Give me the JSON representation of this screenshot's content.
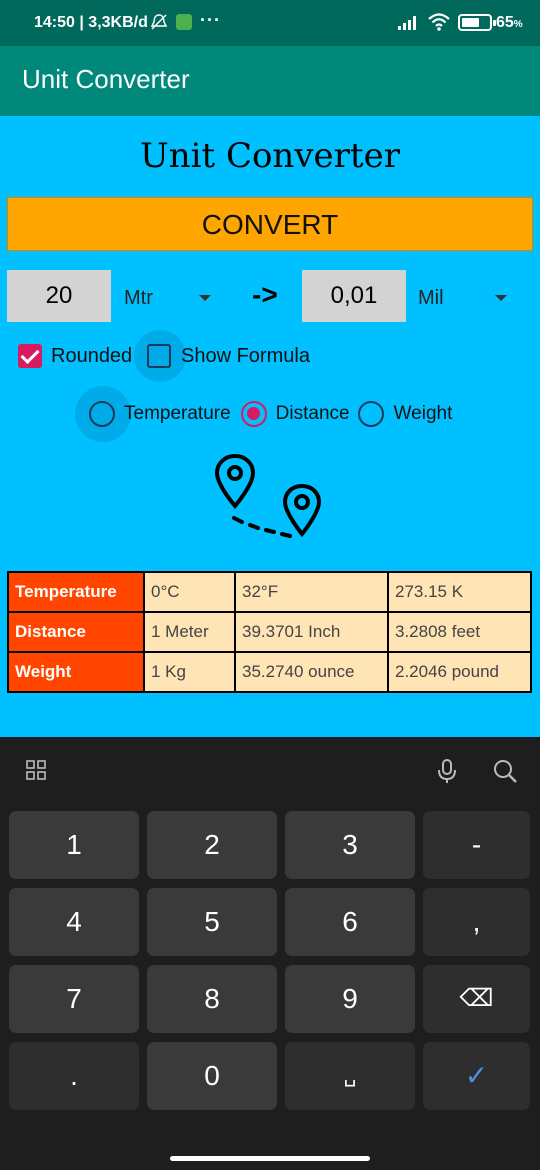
{
  "status_bar": {
    "time": "14:50 | 3,3KB/d",
    "battery": "65",
    "battery_unit": "%",
    "battery_level": 0.65
  },
  "app_bar": {
    "title": "Unit Converter"
  },
  "main": {
    "title": "Unit Converter",
    "convert_label": "CONVERT",
    "from_value": "20",
    "from_unit": "Mtr",
    "arrow": "->",
    "to_value": "0,01",
    "to_unit": "Mil",
    "rounded_label": "Rounded",
    "rounded_checked": true,
    "show_formula_label": "Show Formula",
    "show_formula_checked": false,
    "categories": [
      {
        "label": "Temperature",
        "selected": false
      },
      {
        "label": "Distance",
        "selected": true
      },
      {
        "label": "Weight",
        "selected": false
      }
    ],
    "illustration_icon": "map-pins-route-icon"
  },
  "table": {
    "rows": [
      {
        "label": "Temperature",
        "values": [
          "0°C",
          "32°F",
          "273.15 K"
        ]
      },
      {
        "label": "Distance",
        "values": [
          "1 Meter",
          "39.3701 Inch",
          "3.2808 feet"
        ]
      },
      {
        "label": "Weight",
        "values": [
          "1 Kg",
          "35.2740 ounce",
          "2.2046 pound"
        ]
      }
    ]
  },
  "keyboard": {
    "keys": [
      [
        "1",
        "2",
        "3",
        "-"
      ],
      [
        "4",
        "5",
        "6",
        ","
      ],
      [
        "7",
        "8",
        "9",
        "⌫"
      ],
      [
        ".",
        "0",
        "␣",
        "✓"
      ]
    ]
  },
  "colors": {
    "background": "#00c0ff",
    "app_bar": "#00897b",
    "status_bar": "#00695c",
    "convert_button": "#ffa500",
    "accent": "#d81b60",
    "table_header": "#ff4500",
    "table_cell": "#ffe4b5"
  }
}
